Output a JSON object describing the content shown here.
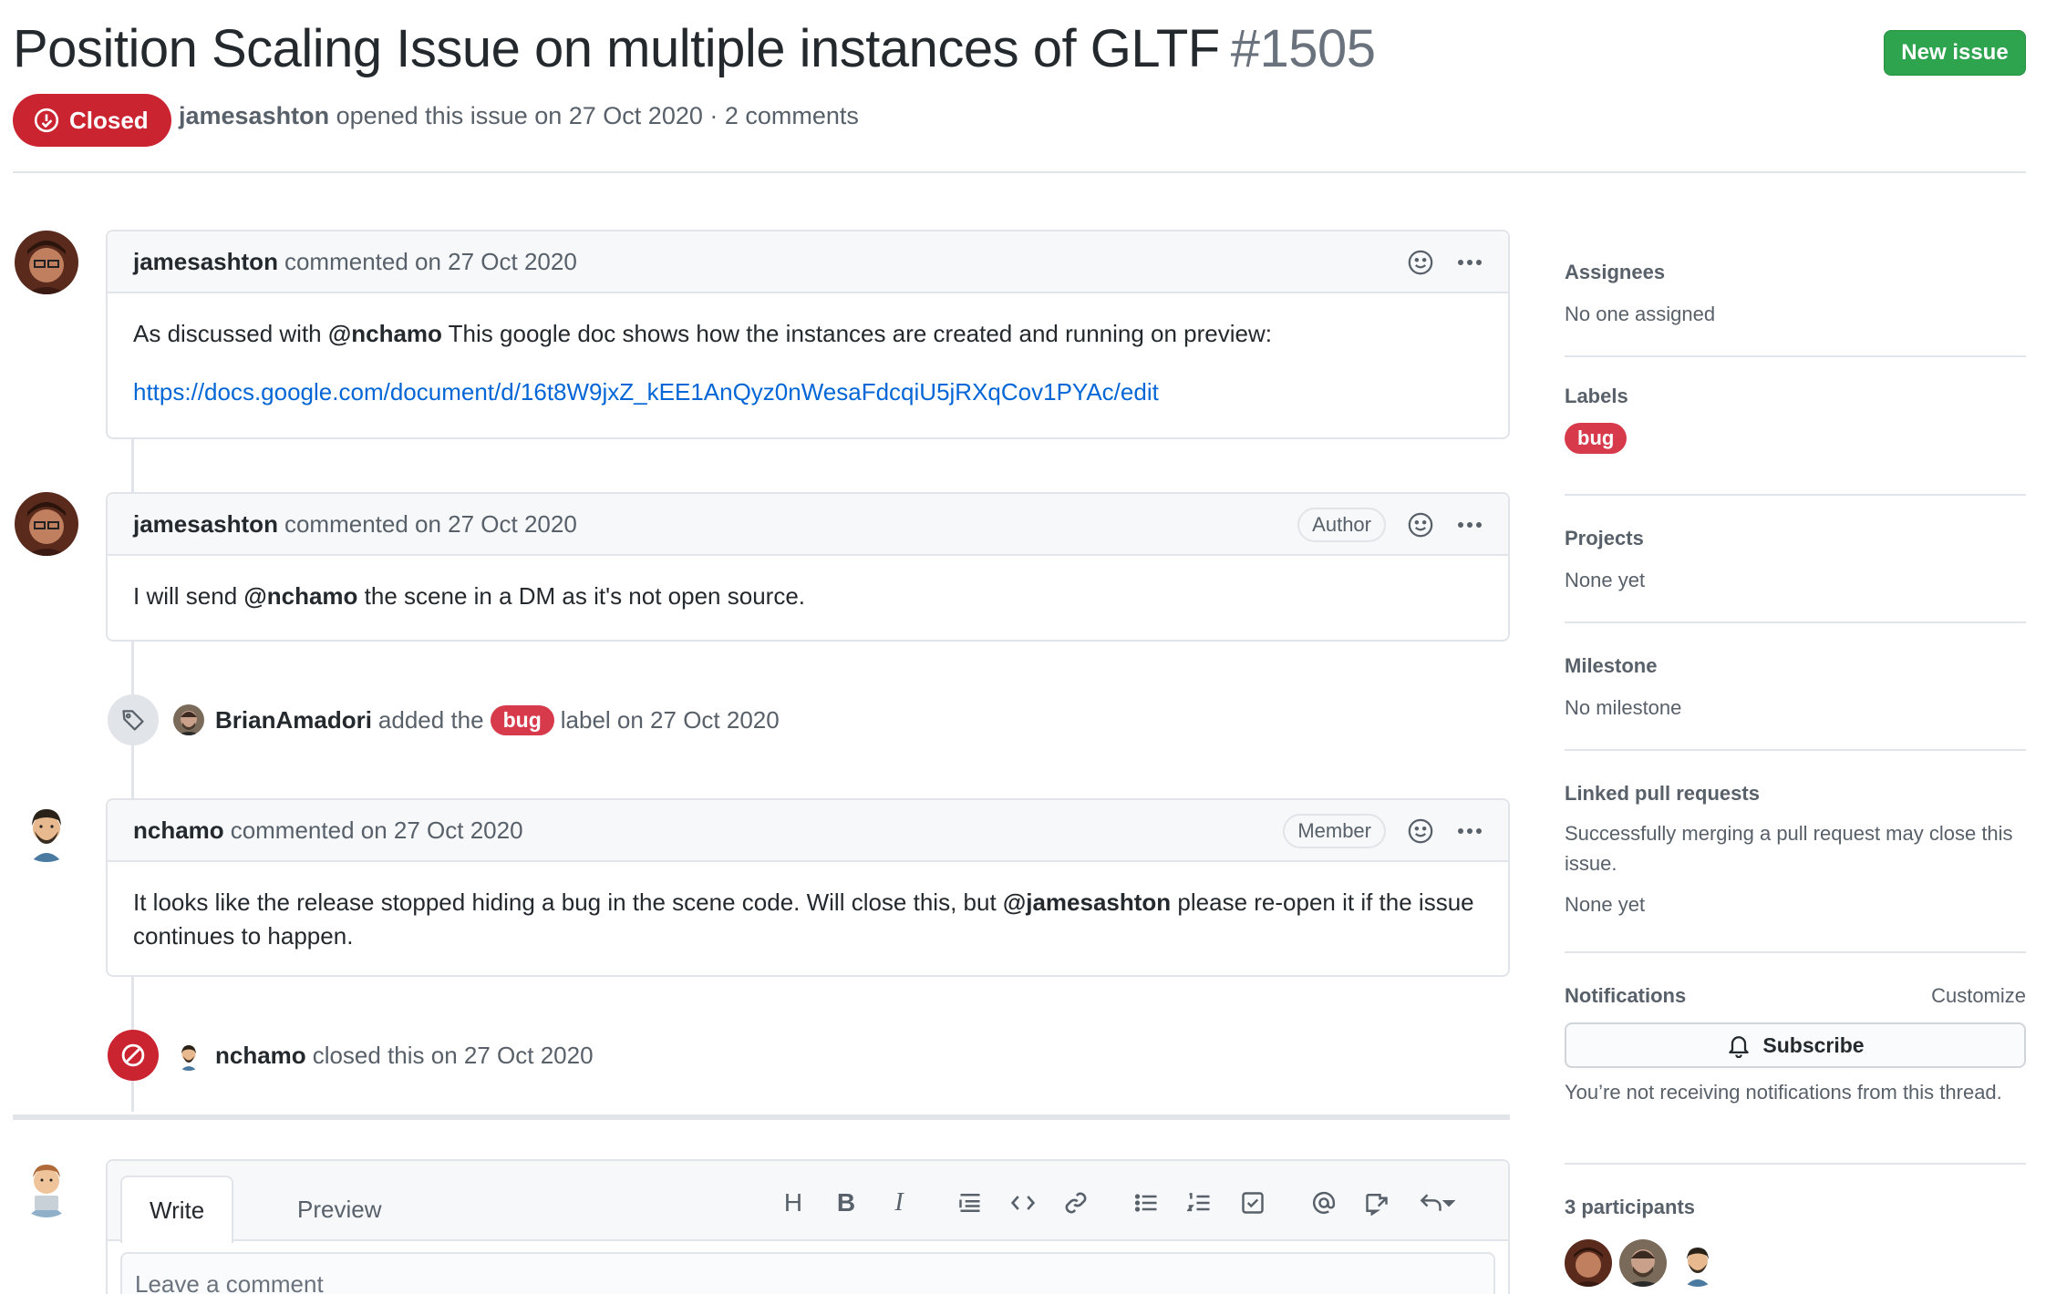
{
  "issue": {
    "title": "Position Scaling Issue on multiple instances of GLTF",
    "number": "#1505",
    "state": "Closed",
    "author": "jamesashton",
    "meta_text": "opened this issue on 27 Oct 2020 · 2 comments",
    "new_issue_label": "New issue"
  },
  "comments": [
    {
      "author": "jamesashton",
      "when": "commented on 27 Oct 2020",
      "badge": "",
      "body_pre": "As discussed with ",
      "body_mention": "@nchamo",
      "body_post": " This google doc shows how the instances are created and running on preview:",
      "link": "https://docs.google.com/document/d/16t8W9jxZ_kEE1AnQyz0nWesaFdcqiU5jRXqCov1PYAc/edit"
    },
    {
      "author": "jamesashton",
      "when": "commented on 27 Oct 2020",
      "badge": "Author",
      "body_pre": "I will send ",
      "body_mention": "@nchamo",
      "body_post": " the scene in a DM as it's not open source."
    },
    {
      "author": "nchamo",
      "when": "commented on 27 Oct 2020",
      "badge": "Member",
      "body_pre": "It looks like the release stopped hiding a bug in the scene code. Will close this, but ",
      "body_mention": "@jamesashton",
      "body_post": " please re-open it if the issue continues to happen."
    }
  ],
  "events": [
    {
      "actor": "BrianAmadori",
      "pre": "added the",
      "label": "bug",
      "post": "label on 27 Oct 2020"
    },
    {
      "actor": "nchamo",
      "text": "closed this on 27 Oct 2020"
    }
  ],
  "editor": {
    "tab_write": "Write",
    "tab_preview": "Preview",
    "placeholder": "Leave a comment",
    "tools": [
      "H",
      "B",
      "I"
    ]
  },
  "sidebar": {
    "assignees_title": "Assignees",
    "assignees_value": "No one assigned",
    "labels_title": "Labels",
    "label": "bug",
    "projects_title": "Projects",
    "projects_value": "None yet",
    "milestone_title": "Milestone",
    "milestone_value": "No milestone",
    "linked_title": "Linked pull requests",
    "linked_desc": "Successfully merging a pull request may close this issue.",
    "linked_value": "None yet",
    "notifications_title": "Notifications",
    "customize": "Customize",
    "subscribe": "Subscribe",
    "notifications_desc": "You’re not receiving notifications from this thread.",
    "participants": "3 participants"
  },
  "colors": {
    "closed": "#cb2431",
    "label_bug": "#d73a4a",
    "new_issue": "#2ea44f",
    "link": "#0366d6"
  }
}
